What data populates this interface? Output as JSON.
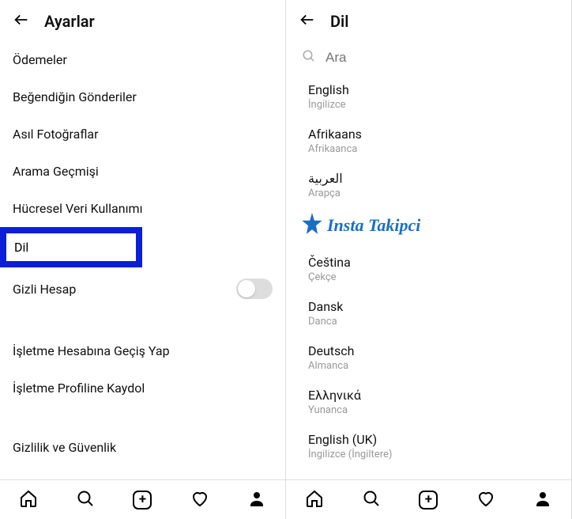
{
  "left": {
    "header_title": "Ayarlar",
    "items": {
      "payments": "Ödemeler",
      "liked_posts": "Beğendiğin Gönderiler",
      "original_photos": "Asıl Fotoğraflar",
      "search_history": "Arama Geçmişi",
      "cellular_data": "Hücresel Veri Kullanımı",
      "language": "Dil",
      "private_account": "Gizli Hesap",
      "switch_business": "İşletme Hesabına Geçiş Yap",
      "save_business_profile": "İşletme Profiline Kaydol",
      "privacy_security": "Gizlilik ve Güvenlik"
    }
  },
  "right": {
    "header_title": "Dil",
    "search_placeholder": "Ara",
    "languages": [
      {
        "primary": "English",
        "secondary": "İngilizce"
      },
      {
        "primary": "Afrikaans",
        "secondary": "Afrikaanca"
      },
      {
        "primary": "العربية",
        "secondary": "Arapça"
      },
      {
        "primary": "Čeština",
        "secondary": "Çekçe"
      },
      {
        "primary": "Dansk",
        "secondary": "Danca"
      },
      {
        "primary": "Deutsch",
        "secondary": "Almanca"
      },
      {
        "primary": "Ελληνικά",
        "secondary": "Yunanca"
      },
      {
        "primary": "English (UK)",
        "secondary": "İngilizce (İngiltere)"
      }
    ],
    "watermark": "Insta Takipci"
  }
}
